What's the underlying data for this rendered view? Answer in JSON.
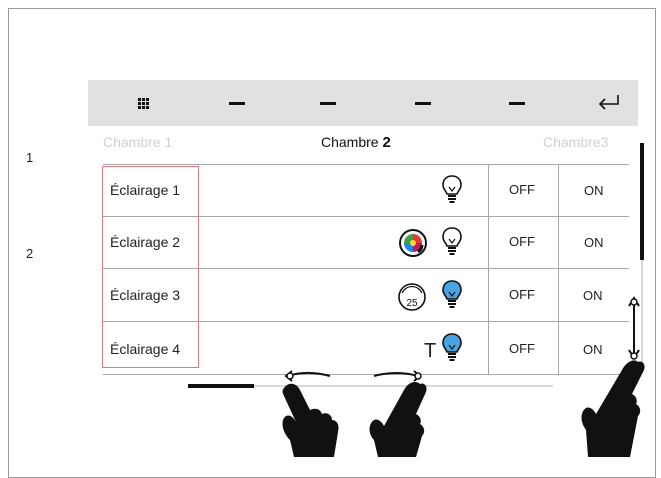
{
  "callouts": [
    "1",
    "2"
  ],
  "toolbar": {
    "icons": [
      "grid-icon",
      "dash-icon",
      "dash-icon",
      "dash-icon",
      "dash-icon",
      "return-icon"
    ]
  },
  "tabs": [
    {
      "label": "Chambre 1",
      "active": false
    },
    {
      "label_prefix": "Chambre ",
      "label_num": "2",
      "active": true
    },
    {
      "label": "Chambre3",
      "active": false
    }
  ],
  "rows": [
    {
      "label": "Éclairage 1",
      "icons": [
        "bulb-outline-icon"
      ],
      "off": "OFF",
      "on": "ON"
    },
    {
      "label": "Éclairage 2",
      "icons": [
        "color-wheel-icon",
        "bulb-outline-icon"
      ],
      "off": "OFF",
      "on": "ON"
    },
    {
      "label": "Éclairage 3",
      "icons": [
        "dimmer-icon",
        "bulb-blue-icon"
      ],
      "dimmer_value": "25",
      "off": "OFF",
      "on": "ON"
    },
    {
      "label": "Éclairage 4",
      "icons": [
        "temperature-T-icon",
        "bulb-blue-icon"
      ],
      "temp_label": "T",
      "off": "OFF",
      "on": "ON"
    }
  ],
  "colors": {
    "toolbar_bg": "#e1e1e1",
    "label_border": "#e07b7b",
    "bulb_blue": "#4aa3e0"
  },
  "gestures": [
    "swipe-left-hand-icon",
    "swipe-right-hand-icon",
    "swipe-vertical-hand-icon"
  ]
}
